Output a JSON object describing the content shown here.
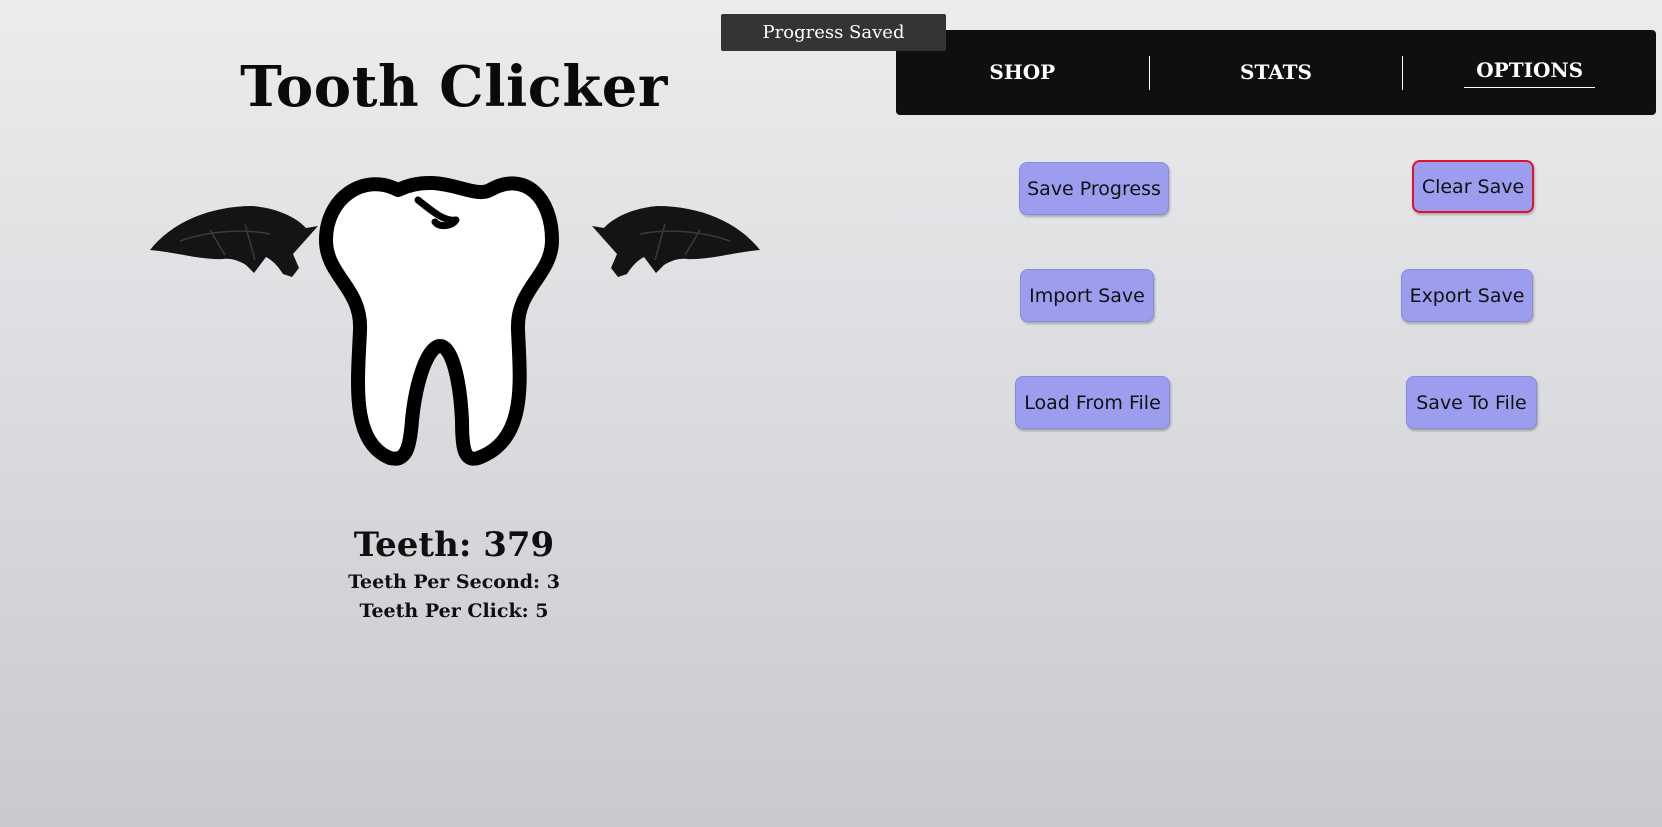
{
  "toast": {
    "text": "Progress Saved"
  },
  "game": {
    "title": "Tooth Clicker",
    "teeth_line": "Teeth: 379",
    "tps_line": "Teeth Per Second: 3",
    "tpc_line": "Teeth Per Click: 5"
  },
  "nav": {
    "tabs": [
      {
        "label": "SHOP"
      },
      {
        "label": "STATS"
      },
      {
        "label": "OPTIONS",
        "active": true
      }
    ]
  },
  "options": {
    "save_progress": "Save Progress",
    "clear_save": "Clear Save",
    "import_save": "Import Save",
    "export_save": "Export Save",
    "load_from_file": "Load From File",
    "save_to_file": "Save To File"
  },
  "icons": {
    "clicker": "winged-tooth-icon",
    "left_wing": "bat-wing-icon",
    "right_wing": "bat-wing-icon"
  },
  "colors": {
    "nav_background": "#0d0f10",
    "button_background": "#9c9def",
    "danger_border": "#e0132f",
    "toast_background": "#343434"
  }
}
